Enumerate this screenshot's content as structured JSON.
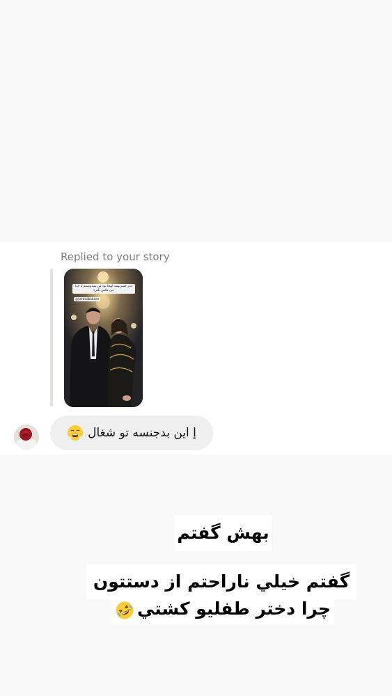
{
  "reply": {
    "label": "Replied to your story",
    "story": {
      "caption": "اندر خشریپشه اونجا بود من نمیدونستم یا خدا دین عکس بگیره",
      "mention": "@karbodbabaee"
    }
  },
  "message": {
    "text": "إ اين بدجنسه تو شغال",
    "emoji": "face-with-steam-from-nose-emoji"
  },
  "captions": {
    "line1": "بهش گفتم",
    "line2": "گفتم خيلي ناراحتم از دستتون",
    "line3": "چرا دختر طفليو كشتي",
    "line3_emoji": "rolling-on-floor-laughing-emoji"
  },
  "colors": {
    "panel_bg": "#ffffff",
    "page_bg": "#f8f8f8",
    "bubble_bg": "#efefef",
    "muted_text": "#7d7d7d"
  }
}
